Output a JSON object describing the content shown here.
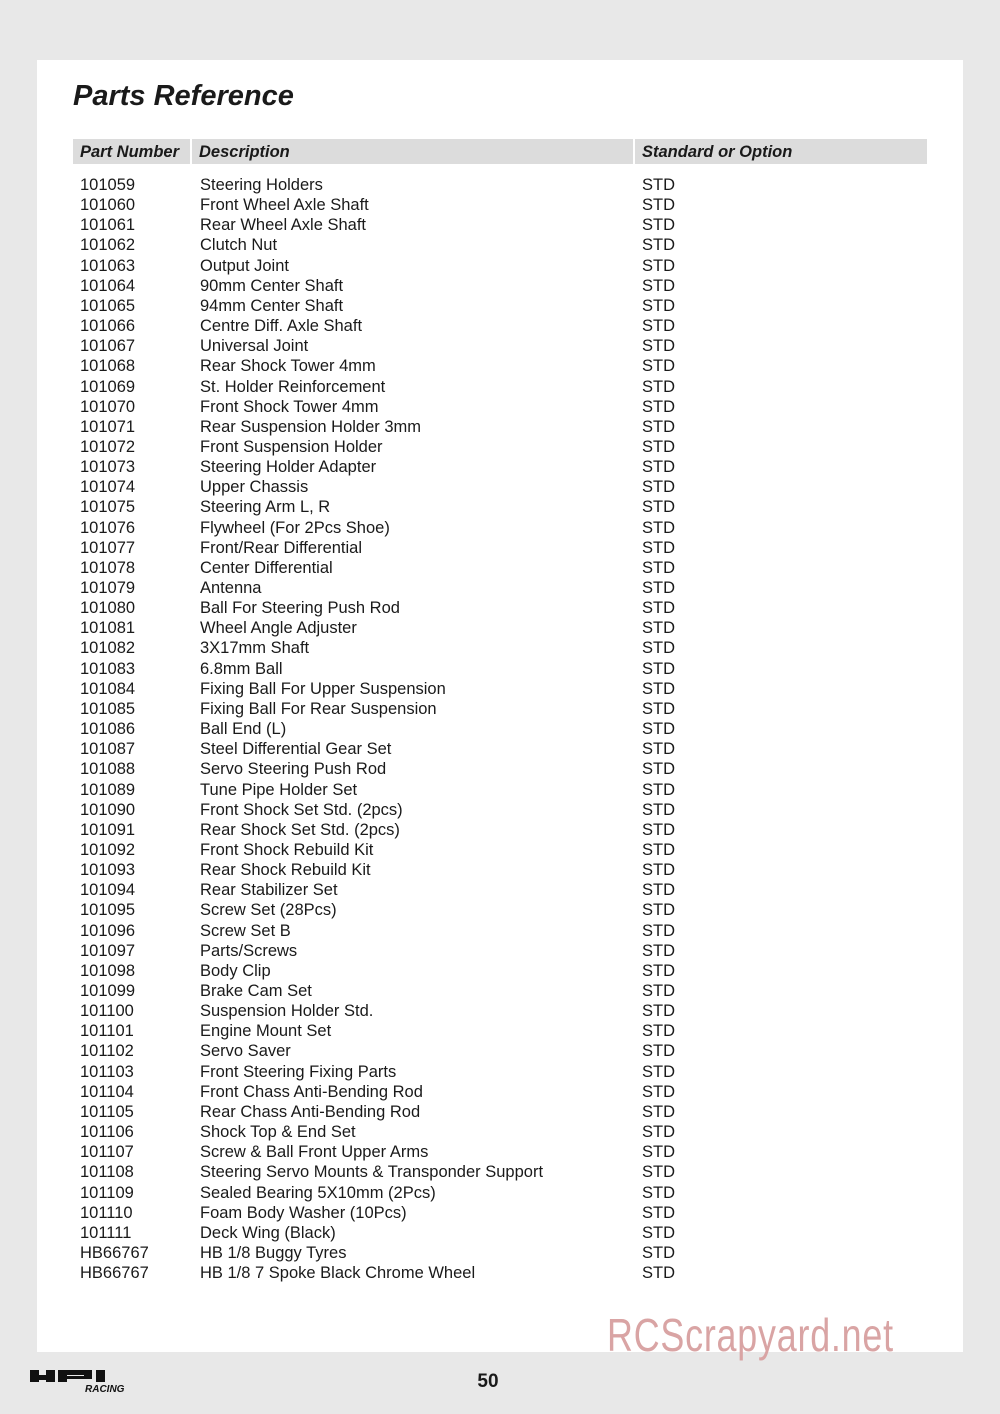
{
  "title": "Parts Reference",
  "columns": [
    "Part Number",
    "Description",
    "Standard or Option"
  ],
  "rows": [
    [
      "101059",
      "Steering Holders",
      "STD"
    ],
    [
      "101060",
      "Front Wheel Axle Shaft",
      "STD"
    ],
    [
      "101061",
      "Rear Wheel Axle Shaft",
      "STD"
    ],
    [
      "101062",
      "Clutch Nut",
      "STD"
    ],
    [
      "101063",
      "Output Joint",
      "STD"
    ],
    [
      "101064",
      "90mm Center Shaft",
      "STD"
    ],
    [
      "101065",
      "94mm Center Shaft",
      "STD"
    ],
    [
      "101066",
      "Centre Diff. Axle Shaft",
      "STD"
    ],
    [
      "101067",
      "Universal Joint",
      "STD"
    ],
    [
      "101068",
      "Rear Shock Tower 4mm",
      "STD"
    ],
    [
      "101069",
      "St. Holder Reinforcement",
      "STD"
    ],
    [
      "101070",
      "Front Shock Tower 4mm",
      "STD"
    ],
    [
      "101071",
      "Rear Suspension Holder 3mm",
      "STD"
    ],
    [
      "101072",
      "Front Suspension Holder",
      "STD"
    ],
    [
      "101073",
      "Steering Holder Adapter",
      "STD"
    ],
    [
      "101074",
      "Upper Chassis",
      "STD"
    ],
    [
      "101075",
      "Steering Arm L, R",
      "STD"
    ],
    [
      "101076",
      "Flywheel (For 2Pcs Shoe)",
      "STD"
    ],
    [
      "101077",
      "Front/Rear Differential",
      "STD"
    ],
    [
      "101078",
      "Center Differential",
      "STD"
    ],
    [
      "101079",
      "Antenna",
      "STD"
    ],
    [
      "101080",
      "Ball For Steering Push Rod",
      "STD"
    ],
    [
      "101081",
      "Wheel Angle Adjuster",
      "STD"
    ],
    [
      "101082",
      "3X17mm Shaft",
      "STD"
    ],
    [
      "101083",
      "6.8mm Ball",
      "STD"
    ],
    [
      "101084",
      "Fixing Ball For Upper Suspension",
      "STD"
    ],
    [
      "101085",
      "Fixing Ball For Rear Suspension",
      "STD"
    ],
    [
      "101086",
      "Ball End (L)",
      "STD"
    ],
    [
      "101087",
      "Steel Differential Gear Set",
      "STD"
    ],
    [
      "101088",
      "Servo Steering Push Rod",
      "STD"
    ],
    [
      "101089",
      "Tune Pipe Holder Set",
      "STD"
    ],
    [
      "101090",
      "Front Shock Set Std. (2pcs)",
      "STD"
    ],
    [
      "101091",
      "Rear Shock Set Std. (2pcs)",
      "STD"
    ],
    [
      "101092",
      "Front Shock Rebuild Kit",
      "STD"
    ],
    [
      "101093",
      "Rear Shock Rebuild Kit",
      "STD"
    ],
    [
      "101094",
      "Rear Stabilizer Set",
      "STD"
    ],
    [
      "101095",
      "Screw Set (28Pcs)",
      "STD"
    ],
    [
      "101096",
      "Screw Set B",
      "STD"
    ],
    [
      "101097",
      "Parts/Screws",
      "STD"
    ],
    [
      "101098",
      "Body Clip",
      "STD"
    ],
    [
      "101099",
      "Brake Cam Set",
      "STD"
    ],
    [
      "101100",
      "Suspension Holder Std.",
      "STD"
    ],
    [
      "101101",
      "Engine Mount Set",
      "STD"
    ],
    [
      "101102",
      "Servo Saver",
      "STD"
    ],
    [
      "101103",
      "Front Steering Fixing Parts",
      "STD"
    ],
    [
      "101104",
      "Front Chass Anti-Bending Rod",
      "STD"
    ],
    [
      "101105",
      "Rear Chass Anti-Bending Rod",
      "STD"
    ],
    [
      "101106",
      "Shock Top & End Set",
      "STD"
    ],
    [
      "101107",
      "Screw & Ball Front Upper Arms",
      "STD"
    ],
    [
      "101108",
      "Steering Servo Mounts & Transponder Support",
      "STD"
    ],
    [
      "101109",
      "Sealed Bearing 5X10mm (2Pcs)",
      "STD"
    ],
    [
      "101110",
      "Foam Body Washer (10Pcs)",
      "STD"
    ],
    [
      "101111",
      "Deck Wing (Black)",
      "STD"
    ],
    [
      "HB66767",
      "HB 1/8 Buggy Tyres",
      "STD"
    ],
    [
      "HB66767",
      "HB 1/8 7 Spoke Black Chrome Wheel",
      "STD"
    ]
  ],
  "page_number": "50",
  "watermark": "RCScrapyard.net",
  "logo": {
    "text": "HPI",
    "subtext": "RACING"
  }
}
